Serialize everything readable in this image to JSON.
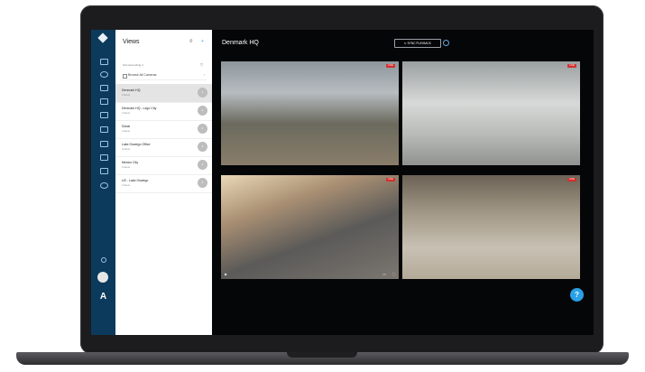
{
  "sidebar": {
    "logo_text": "",
    "footer_label": ""
  },
  "views_panel": {
    "title": "Views",
    "sort_label": "Sort Ascending ∨",
    "browse_label": "Browse All Cameras",
    "items": [
      {
        "name": "Denmark HQ",
        "sub": "4 items",
        "badge": "4"
      },
      {
        "name": "Denmark HQ - Lego City",
        "sub": "4 items",
        "badge": "4"
      },
      {
        "name": "Dubai",
        "sub": "4 items",
        "badge": "4"
      },
      {
        "name": "Lake Oswego Office",
        "sub": "4 items",
        "badge": "4"
      },
      {
        "name": "Mexico City",
        "sub": "4 items",
        "badge": "4"
      },
      {
        "name": "US - Lake Oswego",
        "sub": "4 items",
        "badge": "4"
      }
    ]
  },
  "main": {
    "heading": "Denmark HQ",
    "sync_label": "↻ SYNC PLAYBACK"
  },
  "cameras": [
    {
      "label": "",
      "live": "LIVE"
    },
    {
      "label": "",
      "live": "LIVE"
    },
    {
      "label": "",
      "live": "LIVE"
    },
    {
      "label": "",
      "live": "LIVE"
    }
  ],
  "help_label": "?",
  "colors": {
    "rail": "#0b3a5c",
    "live": "#d32f2f",
    "accent": "#2aa1e6"
  }
}
